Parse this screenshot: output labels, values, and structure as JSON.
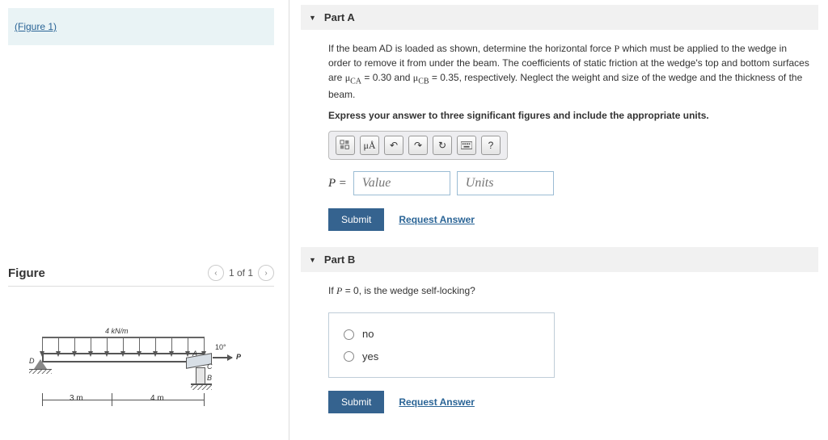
{
  "figure_link": "(Figure 1)",
  "figure": {
    "title": "Figure",
    "pager": "1 of 1",
    "load_label": "4 kN/m",
    "angle_label": "10°",
    "p_label": "P",
    "point_D": "D",
    "point_A": "A",
    "point_C": "C",
    "point_B": "B",
    "dim_3m": "3 m",
    "dim_4m": "4 m"
  },
  "partA": {
    "title": "Part A",
    "question_1": "If the beam AD is loaded as shown, determine the horizontal force ",
    "question_P": "P",
    "question_2": " which must be applied to the wedge in order to remove it from under the beam. The coefficients of static friction at the wedge's top and bottom surfaces are ",
    "mu_ca": "μ",
    "mu_ca_sub": "CA",
    "mu_ca_eq": " = 0.30",
    "question_3": " and ",
    "mu_cb": "μ",
    "mu_cb_sub": "CB",
    "mu_cb_eq": " = 0.35",
    "question_4": ", respectively. Neglect the weight and size of the wedge and the thickness of the beam.",
    "instruction": "Express your answer to three significant figures and include the appropriate units.",
    "toolbar": {
      "units_btn": "μÅ",
      "help": "?"
    },
    "P_label": "P =",
    "value_placeholder": "Value",
    "units_placeholder": "Units",
    "submit": "Submit",
    "request_answer": "Request Answer"
  },
  "partB": {
    "title": "Part B",
    "question_1": "If ",
    "question_P": "P",
    "question_2": " = 0, is the wedge self-locking?",
    "options": {
      "no": "no",
      "yes": "yes"
    },
    "submit": "Submit",
    "request_answer": "Request Answer"
  }
}
